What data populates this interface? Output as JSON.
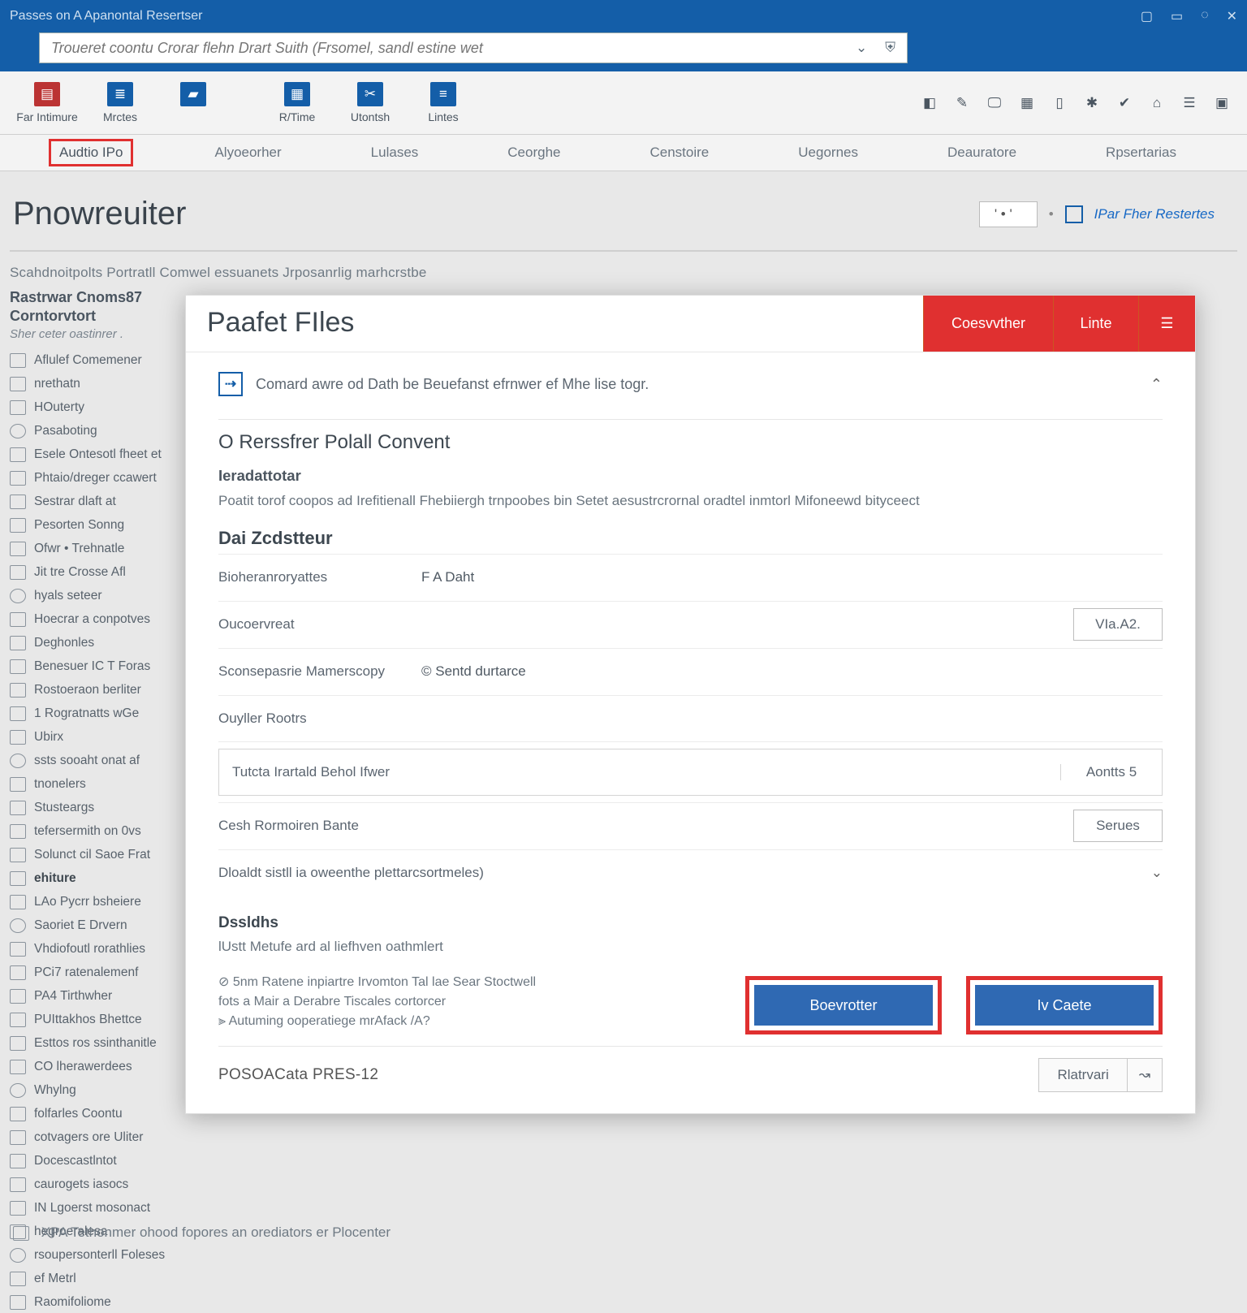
{
  "titlebar": {
    "app_title": "Passes on A Apanontal Resertser"
  },
  "search": {
    "placeholder": "Troueret coontu Crorar flehn Drart Suith (Frsomel, sandl estine wet"
  },
  "ribbon": {
    "groups": [
      {
        "label": "Far Intimure"
      },
      {
        "label": "Mrctes"
      },
      {
        "label": "R/Time"
      },
      {
        "label": "Utontsh"
      },
      {
        "label": "Lintes"
      }
    ]
  },
  "tabs": [
    {
      "label": "Audtio IPo",
      "selected": true
    },
    {
      "label": "Alyoeorher"
    },
    {
      "label": "Lulases"
    },
    {
      "label": "Ceorghe"
    },
    {
      "label": "Censtoire"
    },
    {
      "label": "Uegornes"
    },
    {
      "label": "Deauratore"
    },
    {
      "label": "Rpsertarias"
    }
  ],
  "page": {
    "title": "Pnowreuiter",
    "counter": "'  •  '",
    "link": "IPar Fher Restertes",
    "subline": "Scahdnoitpolts Portratll Comwel essuanets Jrposanrlig marhcrstbe"
  },
  "sidebar": {
    "block_title": "Rastrwar Cnoms87 Corntorvtort",
    "block_sub": "Sher ceter oastinrer .",
    "items": [
      "Aflulef Comemener",
      "nrethatn",
      "HOuterty",
      "Pasaboting",
      "Esele Ontesotl fheet et",
      "Phtaio/dreger ccawert",
      "Sestrar dlaft at",
      "Pesorten Sonng",
      "Ofwr • Trehnatle",
      "Jit tre Crosse Afl",
      "hyals seteer",
      "Hoecrar a conpotves",
      "Deghonles",
      "Benesuer IC T Foras",
      "Rostoeraon berliter",
      "1 Rogratnatts wGe",
      "Ubirx",
      "ssts sooaht onat af",
      "tnonelers",
      "Stusteargs",
      "tefersermith on 0vs",
      "Solunct cil Saoe Frat",
      "ehiture",
      "LAo Pycrr bsheiere",
      "Saoriet E Drvern",
      "Vhdiofoutl rorathlies",
      "PCi7 ratenalemenf",
      "PA4 Tirthwher",
      "PUIttakhos Bhettce",
      "Esttos ros ssinthanitle",
      "CO lherawerdees",
      "Whylng",
      "folfarles Coontu",
      "cotvagers ore Uliter",
      "Docescastlntot",
      "caurogets iasocs",
      "IN Lgoerst mosonact",
      "hegroeralesa",
      "rsoupersonterll Foleses",
      "ef Metrl",
      "Raomifoliome"
    ]
  },
  "dialog": {
    "title": "Paafet FIles",
    "hdr_btns": {
      "primary": "Coesvvther",
      "secondary": "Linte"
    },
    "info_line": "Comard awre od Dath be Beuefanst efrnwer ef Mhe lise togr.",
    "section1": {
      "title": "O Rerssfrer Polall Convent",
      "subhead": "Ieradattotar",
      "text": "Poatit torof coopos ad Irefitienall Fhebiiergh trnpoobes bin Setet aesustrcrornal oradtel inmtorl Mifoneewd bityceect"
    },
    "cluster_title": "Dai Zcdstteur",
    "rows": {
      "r1_label": "Bioheranroryattes",
      "r1_val": "F A Daht",
      "r2_label": "Oucoervreat",
      "r2_btn": "VIa.A2.",
      "r3_label": "Sconsepasrie Mamerscopy",
      "r3_val": "© Sentd durtarce",
      "r4_label": "Ouyller Rootrs",
      "full_label": "Tutcta Irartald Behol Ifwer",
      "full_btn": "Aontts 5",
      "r5_label": "Cesh Rormoiren Bante",
      "r5_btn": "Serues",
      "disclosure": "Dloaldt sistll ia oweenthe plettarcsortmeles)"
    },
    "details_head": "Dssldhs",
    "details_text": "lUstt Metufe ard al liefhven oathmlert",
    "notes": {
      "n1": "⊘ 5nm Ratene inpiartre Irvomton Tal lae Sear Stoctwell",
      "n2": "  fots a Mair a Derabre Tiscales cortorcer",
      "n3": "⫸ Autuming ooperatiege mrAfack /A?"
    },
    "actions": {
      "left": "Boevrotter",
      "right": "Iv Caete"
    },
    "footer_title": "POSOACata PRES-12",
    "footer_btn": "Rlatrvari"
  },
  "bottom_line": "XPA Tethonmer ohood   fopores an orediators er Plocenter"
}
